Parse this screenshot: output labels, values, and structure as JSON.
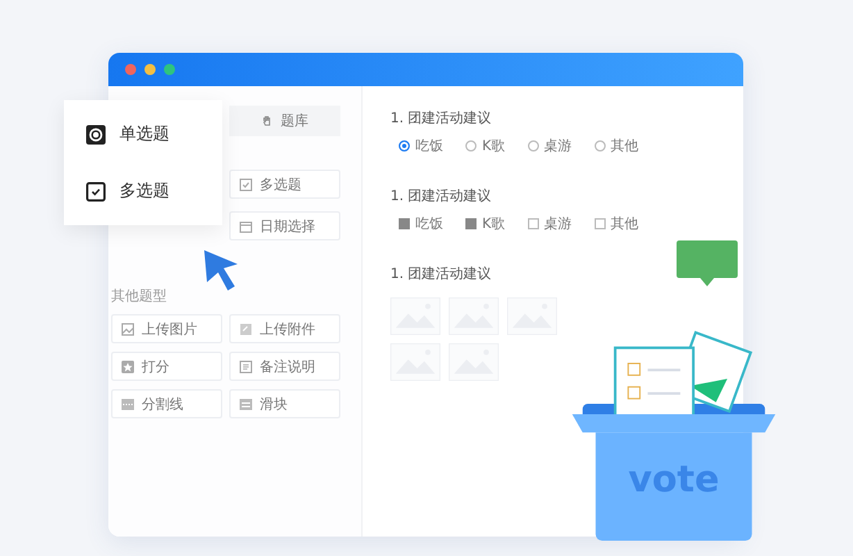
{
  "floating_card": {
    "items": [
      {
        "kind": "radio",
        "label": "单选题"
      },
      {
        "kind": "checkbox",
        "label": "多选题"
      }
    ]
  },
  "library_tab": {
    "label": "题库"
  },
  "question_types": [
    {
      "kind": "checkbox",
      "label": "多选题"
    },
    {
      "kind": "date",
      "label": "日期选择"
    }
  ],
  "other_types": {
    "title": "其他题型",
    "items": [
      {
        "kind": "image",
        "label": "上传图片"
      },
      {
        "kind": "file",
        "label": "上传附件"
      },
      {
        "kind": "score",
        "label": "打分"
      },
      {
        "kind": "note",
        "label": "备注说明"
      },
      {
        "kind": "divider",
        "label": "分割线"
      },
      {
        "kind": "slider",
        "label": "滑块"
      }
    ]
  },
  "questions": [
    {
      "kind": "radio",
      "title": "1. 团建活动建议",
      "options": [
        {
          "label": "吃饭",
          "selected": true
        },
        {
          "label": "K歌",
          "selected": false
        },
        {
          "label": "桌游",
          "selected": false
        },
        {
          "label": "其他",
          "selected": false
        }
      ]
    },
    {
      "kind": "checkbox",
      "title": "1. 团建活动建议",
      "options": [
        {
          "label": "吃饭",
          "selected": true
        },
        {
          "label": "K歌",
          "selected": true
        },
        {
          "label": "桌游",
          "selected": false
        },
        {
          "label": "其他",
          "selected": false
        }
      ]
    },
    {
      "kind": "image",
      "title": "1. 团建活动建议"
    }
  ],
  "vote_box": {
    "label": "vote"
  }
}
